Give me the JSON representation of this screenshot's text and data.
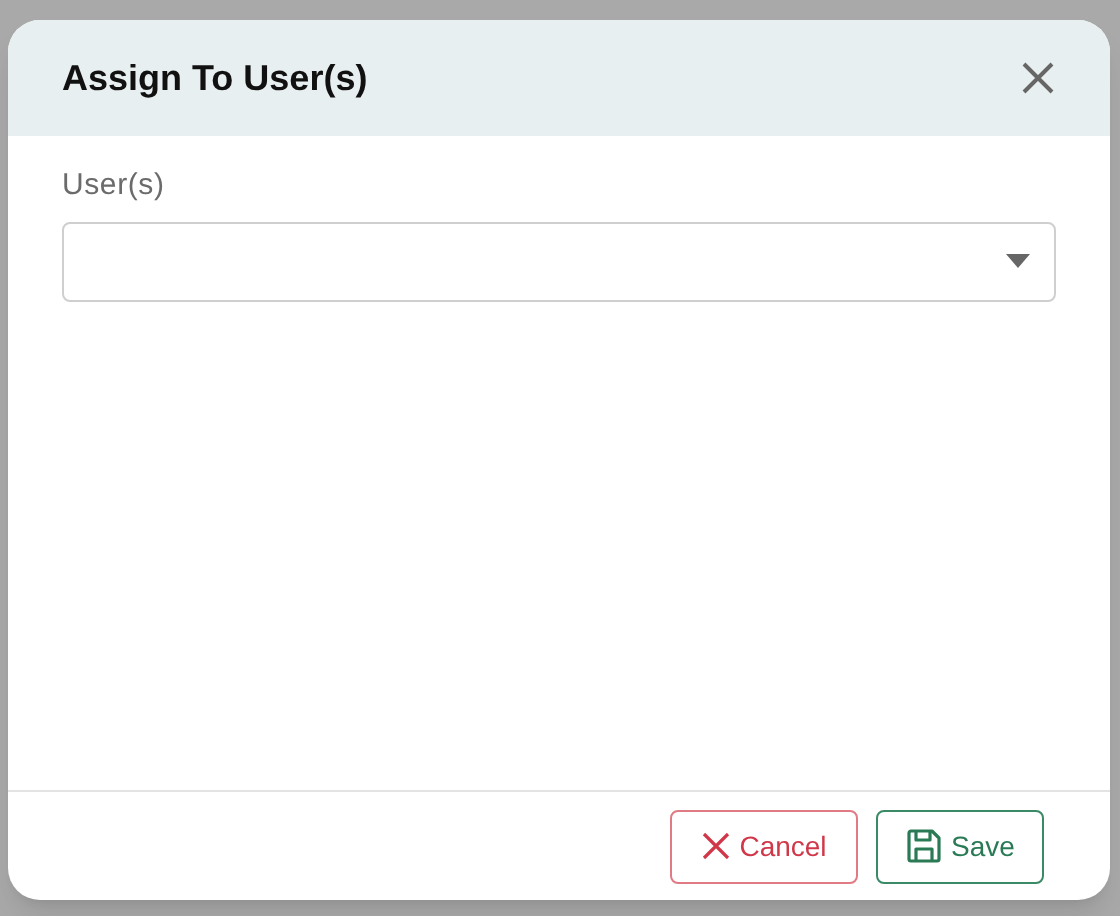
{
  "dialog": {
    "title": "Assign To User(s)",
    "fields": [
      {
        "label": "User(s)",
        "kind": "select"
      }
    ],
    "buttons": [
      {
        "label": "Cancel",
        "kind": "cancel"
      },
      {
        "label": "Save",
        "kind": "save"
      }
    ]
  }
}
